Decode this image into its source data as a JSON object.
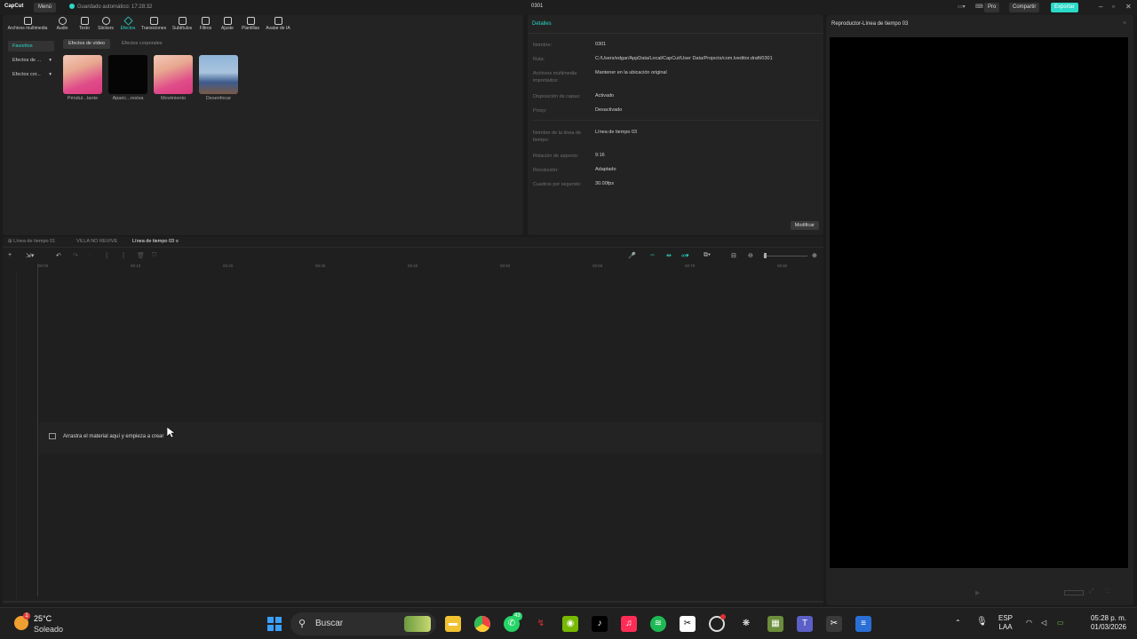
{
  "titlebar": {
    "logo": "CapCut",
    "menu": "Menú",
    "autosave": "Guardado automático: 17:28:32",
    "project_title": "0301",
    "pro": "Pro",
    "share": "Compartir",
    "export": "Exportar"
  },
  "toolbar": {
    "tabs": [
      {
        "label": "Archivos multimedia"
      },
      {
        "label": "Audio"
      },
      {
        "label": "Texto"
      },
      {
        "label": "Stickers"
      },
      {
        "label": "Efectos"
      },
      {
        "label": "Transiciones"
      },
      {
        "label": "Subtítulos"
      },
      {
        "label": "Filtros"
      },
      {
        "label": "Ajuste"
      },
      {
        "label": "Plantillas"
      },
      {
        "label": "Avatar de IA"
      }
    ],
    "active": "Efectos"
  },
  "media": {
    "sidebar": [
      {
        "label": "Favoritos"
      },
      {
        "label": "Efectos de ..."
      },
      {
        "label": "Efectos cor..."
      }
    ],
    "pills": [
      "Efectos de vídeo",
      "Efectos corporales"
    ],
    "items": [
      {
        "label": "Pénduí...tante"
      },
      {
        "label": "Aparic...resiva"
      },
      {
        "label": "Movimiento"
      },
      {
        "label": "Desenfocar"
      }
    ]
  },
  "details": {
    "title": "Detalles",
    "rows": [
      {
        "key": "Nombre:",
        "value": "0301"
      },
      {
        "key": "Ruta:",
        "value": "C:/Users/edgar/AppData/Local/CapCut/User Data/Projects/com.lveditor.draft/0301"
      },
      {
        "key": "Archivos multimedia importados:",
        "value": "Mantener en la ubicación original"
      },
      {
        "key": "Disposición de capas:",
        "value": "Activado"
      },
      {
        "key": "Proxy:",
        "value": "Desactivado"
      },
      {
        "key": "Nombre de la línea de tiempo:",
        "value": "Línea de tiempo 03"
      },
      {
        "key": "Relación de aspecto:",
        "value": "9:16"
      },
      {
        "key": "Resolución:",
        "value": "Adaptado"
      },
      {
        "key": "Cuadros por segundo:",
        "value": "30.00fps"
      }
    ],
    "modify": "Modificar"
  },
  "player": {
    "title": "Reproductor-Línea de tiempo 03"
  },
  "timeline": {
    "tabs": [
      "Línea de tiempo 01",
      "VILLA NO REVIVE",
      "Línea de tiempo 03"
    ],
    "ruler": [
      "00:00",
      "00:10",
      "00:20",
      "00:30",
      "00:40",
      "00:50",
      "00:60",
      "00:70",
      "00:80"
    ],
    "drop_hint": "Arrastra el material aquí y empieza a crear"
  },
  "taskbar": {
    "weather_temp": "25°C",
    "weather_desc": "Soleado",
    "search": "Buscar",
    "whatsapp_badge": "43",
    "lang": "ESP",
    "lang2": "LAA",
    "time": "05:28 p. m.",
    "date": "01/03/2026"
  }
}
